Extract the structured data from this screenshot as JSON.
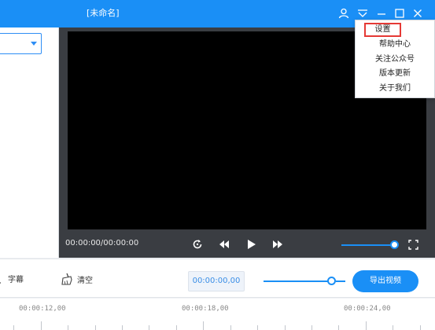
{
  "window": {
    "title": "[未命名]",
    "icons": {
      "user": "user-icon",
      "menu": "menu-down-icon",
      "minimize": "minimize-icon",
      "maximize": "maximize-icon",
      "close": "close-icon"
    },
    "accent_color": "#1a8ff6"
  },
  "menu": {
    "items": [
      "设置",
      "帮助中心",
      "关注公众号",
      "版本更新",
      "关于我们"
    ],
    "highlighted": "设置"
  },
  "player": {
    "timecode": "00:00:00/00:00:00",
    "icons": {
      "replay": "replay-icon",
      "rewind": "rewind-icon",
      "play": "play-icon",
      "forward": "forward-icon",
      "fullscreen": "fullscreen-icon"
    },
    "volume": 1.0
  },
  "toolbar": {
    "subtitle_label": "字幕",
    "clear_label": "清空",
    "timecode": "00:00:00,00",
    "export_label": "导出视频",
    "zoom": 0.85,
    "icons": {
      "subtitle": "subtitle-icon",
      "clear": "broom-icon"
    }
  },
  "timeline": {
    "labels": [
      "00:00:12,00",
      "00:00:18,00",
      "00:00:24,00"
    ]
  }
}
